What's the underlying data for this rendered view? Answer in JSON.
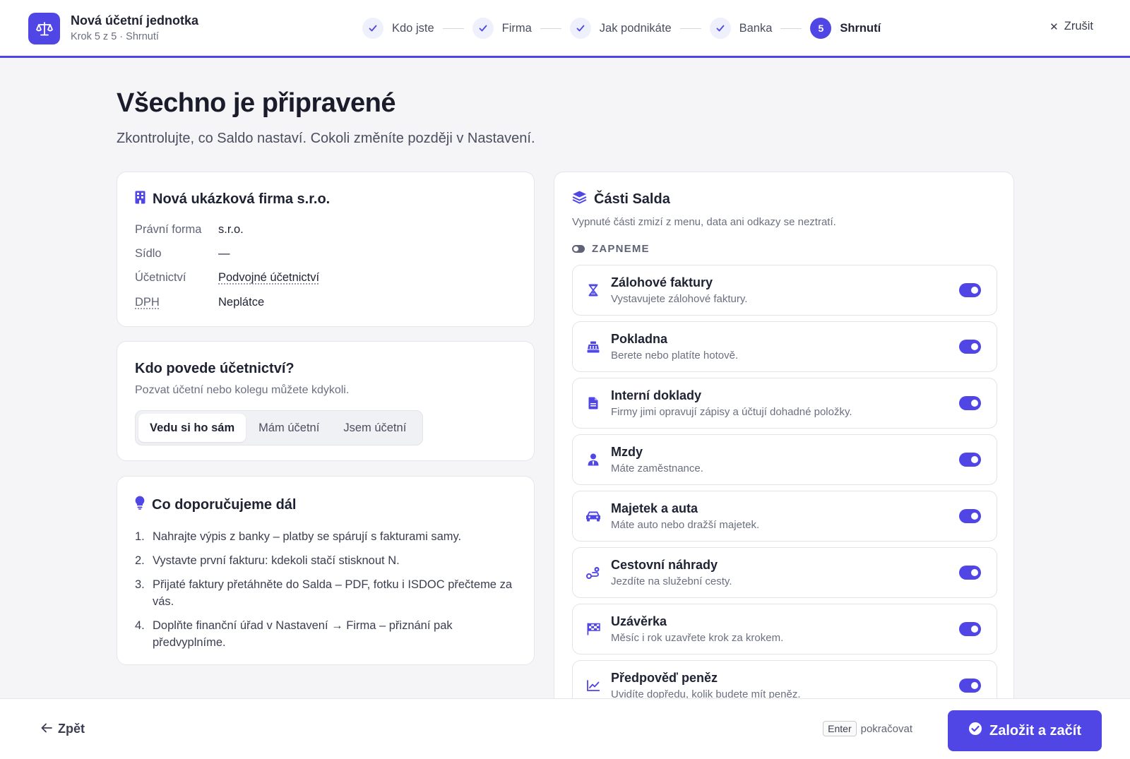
{
  "header": {
    "title": "Nová účetní jednotka",
    "subtitle": "Krok 5 z 5 · Shrnutí",
    "cancel_label": "Zrušit",
    "steps": [
      {
        "label": "Kdo jste",
        "state": "done"
      },
      {
        "label": "Firma",
        "state": "done"
      },
      {
        "label": "Jak podnikáte",
        "state": "done"
      },
      {
        "label": "Banka",
        "state": "done"
      },
      {
        "label": "Shrnutí",
        "state": "active",
        "number": "5"
      }
    ]
  },
  "page": {
    "title": "Všechno je připravené",
    "subtitle": "Zkontrolujte, co Saldo nastaví. Cokoli změníte později v Nastavení."
  },
  "company": {
    "name": "Nová ukázková firma s.r.o.",
    "rows": [
      {
        "key": "Právní forma",
        "value": "s.r.o."
      },
      {
        "key": "Sídlo",
        "value": "—"
      },
      {
        "key": "Účetnictví",
        "value": "Podvojné účetnictví"
      },
      {
        "key": "DPH",
        "value": "Neplátce"
      }
    ]
  },
  "who": {
    "title": "Kdo povede účetnictví?",
    "subtitle": "Pozvat účetní nebo kolegu můžete kdykoli.",
    "options": [
      "Vedu si ho sám",
      "Mám účetní",
      "Jsem účetní"
    ],
    "selected": "Vedu si ho sám"
  },
  "tips": {
    "title": "Co doporučujeme dál",
    "items": [
      {
        "num": "1.",
        "text": "Nahrajte výpis z banky – platby se spárují s fakturami samy."
      },
      {
        "num": "2.",
        "text": "Vystavte první fakturu: kdekoli stačí stisknout N."
      },
      {
        "num": "3.",
        "text": "Přijaté faktury přetáhněte do Salda – PDF, fotku i ISDOC přečteme za vás."
      },
      {
        "num": "4.",
        "text": "Doplňte finanční úřad v Nastavení → Firma – přiznání pak předvyplníme."
      }
    ]
  },
  "parts": {
    "title": "Části Salda",
    "subtitle": "Vypnuté části zmizí z menu, data ani odkazy se neztratí.",
    "section_label": "ZAPNEME",
    "modules": [
      {
        "name": "Zálohové faktury",
        "desc": "Vystavujete zálohové faktury.",
        "icon": "hourglass-icon",
        "enabled": true
      },
      {
        "name": "Pokladna",
        "desc": "Berete nebo platíte hotově.",
        "icon": "cash-register-icon",
        "enabled": true
      },
      {
        "name": "Interní doklady",
        "desc": "Firmy jimi opravují zápisy a účtují dohadné položky.",
        "icon": "document-icon",
        "enabled": true
      },
      {
        "name": "Mzdy",
        "desc": "Máte zaměstnance.",
        "icon": "user-tie-icon",
        "enabled": true
      },
      {
        "name": "Majetek a auta",
        "desc": "Máte auto nebo dražší majetek.",
        "icon": "car-icon",
        "enabled": true
      },
      {
        "name": "Cestovní náhrady",
        "desc": "Jezdíte na služební cesty.",
        "icon": "route-icon",
        "enabled": true
      },
      {
        "name": "Uzávěrka",
        "desc": "Měsíc i rok uzavřete krok za krokem.",
        "icon": "checkered-flag-icon",
        "enabled": true
      },
      {
        "name": "Předpověď peněz",
        "desc": "Uvidíte dopředu, kolik budete mít peněz.",
        "icon": "chart-line-icon",
        "enabled": true
      }
    ]
  },
  "footer": {
    "back_label": "Zpět",
    "kbd": "Enter",
    "hint": "pokračovat",
    "primary_label": "Založit a začít"
  },
  "colors": {
    "accent": "#4f46e5",
    "background": "#f5f5f7"
  }
}
